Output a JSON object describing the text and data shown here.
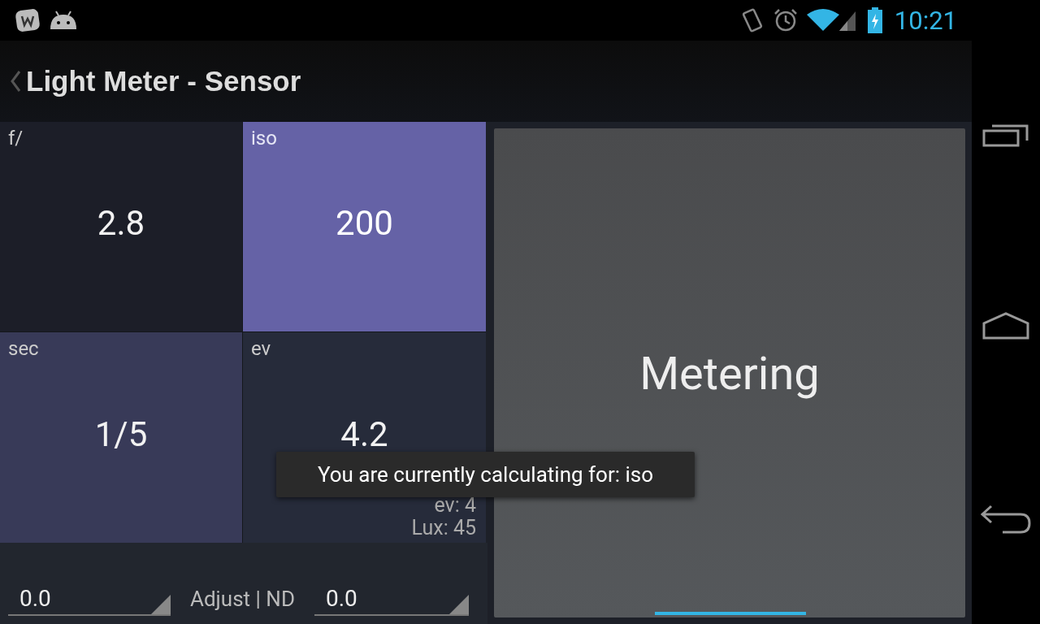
{
  "status_bar": {
    "time": "10:21"
  },
  "action_bar": {
    "title": "Light Meter - Sensor"
  },
  "cells": [
    {
      "label": "f/",
      "value": "2.8",
      "selected": false,
      "color": "#1c1e28"
    },
    {
      "label": "iso",
      "value": "200",
      "selected": true,
      "color": "#6562a6"
    },
    {
      "label": "sec",
      "value": "1/5",
      "selected": false,
      "color": "#383a58"
    },
    {
      "label": "ev",
      "value": "4.2",
      "selected": false,
      "color": "#262b3a",
      "details": [
        "ev: 4",
        "Lux: 45"
      ]
    }
  ],
  "adjust": {
    "left_value": "0.0",
    "label": "Adjust | ND",
    "right_value": "0.0"
  },
  "meter_button": {
    "label": "Metering"
  },
  "toast": {
    "message": "You are currently calculating for: iso"
  }
}
